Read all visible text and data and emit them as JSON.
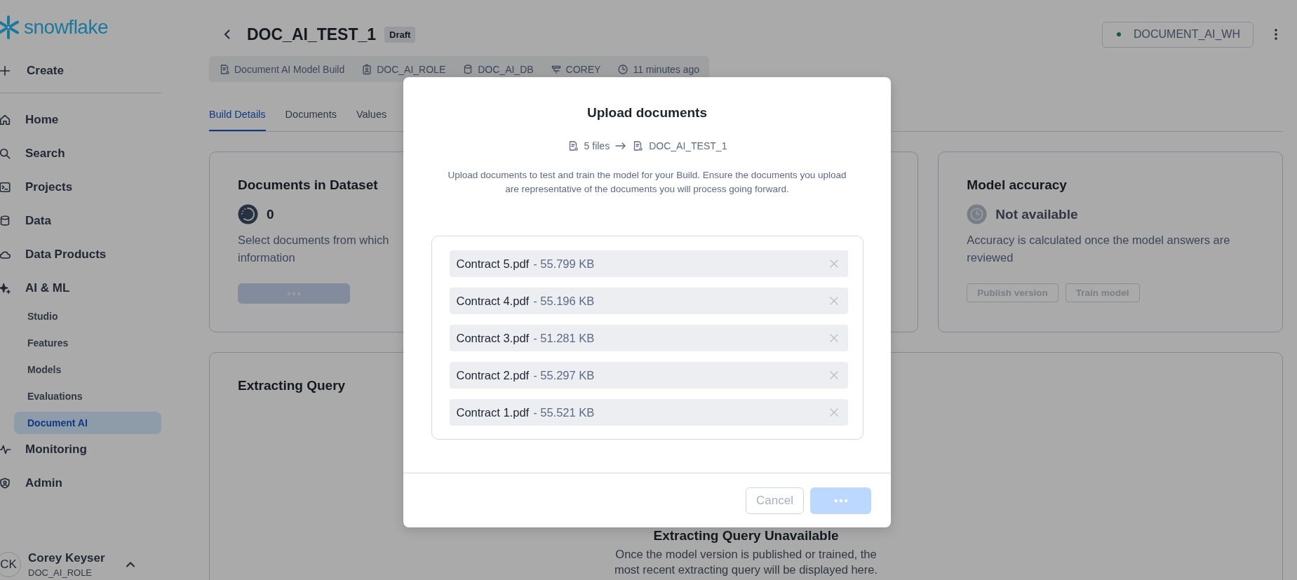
{
  "sidebar": {
    "logo": "snowflake",
    "create": {
      "label": "Create"
    },
    "items": [
      {
        "label": "Home",
        "kind": "home",
        "selected": false
      },
      {
        "label": "Search",
        "kind": "search",
        "selected": false
      },
      {
        "label": "Projects",
        "kind": "projects",
        "selected": false
      },
      {
        "label": "Data",
        "kind": "data",
        "selected": false
      },
      {
        "label": "Data Products",
        "kind": "cloud",
        "selected": false
      },
      {
        "label": "AI & ML",
        "kind": "sparkle",
        "selected": false,
        "children": [
          {
            "label": "Studio",
            "selected": false
          },
          {
            "label": "Features",
            "selected": false
          },
          {
            "label": "Models",
            "selected": false
          },
          {
            "label": "Evaluations",
            "selected": false
          },
          {
            "label": "Document AI",
            "selected": true
          }
        ]
      },
      {
        "label": "Monitoring",
        "kind": "pulse",
        "selected": false
      },
      {
        "label": "Admin",
        "kind": "shield",
        "selected": false
      }
    ],
    "user": {
      "initials": "CK",
      "name": "Corey Keyser",
      "role": "DOC_AI_ROLE"
    }
  },
  "header": {
    "title": "DOC_AI_TEST_1",
    "badge": "Draft",
    "warehouse": "DOCUMENT_AI_WH",
    "breadcrumbs": [
      {
        "kind": "build",
        "label": "Document AI Model Build"
      },
      {
        "kind": "role",
        "label": "DOC_AI_ROLE"
      },
      {
        "kind": "database",
        "label": "DOC_AI_DB"
      },
      {
        "kind": "schema",
        "label": "COREY"
      },
      {
        "kind": "time",
        "label": "11 minutes ago"
      }
    ]
  },
  "tabs": [
    {
      "label": "Build Details",
      "selected": true
    },
    {
      "label": "Documents",
      "selected": false
    },
    {
      "label": "Values",
      "selected": false
    }
  ],
  "dataset_card": {
    "title": "Documents in Dataset",
    "count": "0",
    "lines": [
      "Select documents from which",
      "information"
    ],
    "button": {
      "loading": true
    }
  },
  "accuracy_card": {
    "title": "Model accuracy",
    "status": "Not available",
    "description": "Accuracy is calculated once the model answers are reviewed",
    "buttons": [
      {
        "label": "Publish version",
        "disabled": true
      },
      {
        "label": "Train model",
        "disabled": true
      }
    ]
  },
  "query_card": {
    "title": "Extracting Query",
    "empty_title": "Extracting Query Unavailable",
    "empty_text": "Once the model version is published or trained, the most recent extracting query will be displayed here."
  },
  "modal": {
    "title": "Upload documents",
    "count": "5 files",
    "target": "DOC_AI_TEST_1",
    "description": "Upload documents to test and train the model for your Build. Ensure the documents you upload are representative of the documents you will process going forward.",
    "files": [
      {
        "name": "Contract 5.pdf",
        "size": "- 55.799 KB"
      },
      {
        "name": "Contract 4.pdf",
        "size": "- 55.196 KB"
      },
      {
        "name": "Contract 3.pdf",
        "size": "- 51.281 KB"
      },
      {
        "name": "Contract 2.pdf",
        "size": "- 55.297 KB"
      },
      {
        "name": "Contract 1.pdf",
        "size": "- 55.521 KB"
      }
    ],
    "cancel": {
      "label": "Cancel",
      "disabled": true
    },
    "submit": {
      "loading": true
    }
  }
}
